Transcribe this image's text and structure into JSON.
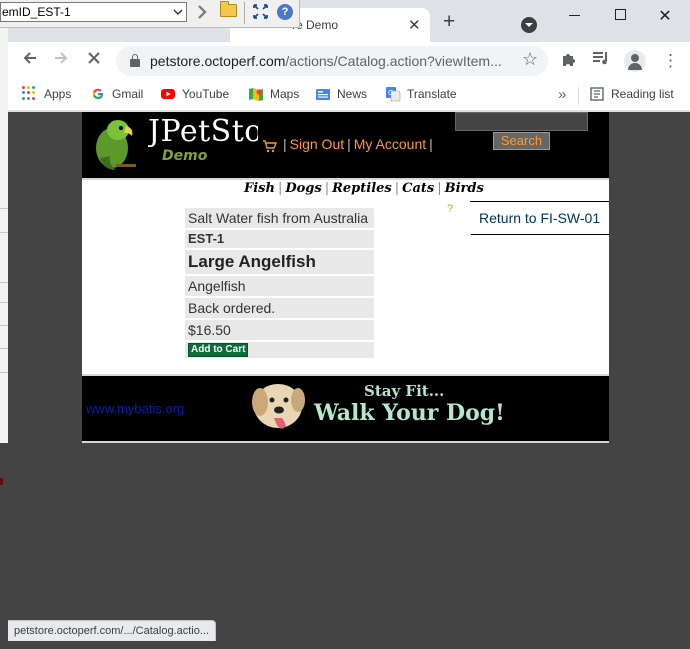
{
  "browser": {
    "tab_title": "re Demo",
    "new_tab_symbol": "+",
    "close_symbol": "✕",
    "url_host": "petstore.octoperf.com",
    "url_path": "/actions/Catalog.action?viewItem...",
    "bookmarks": [
      {
        "label": "Apps",
        "icon": "apps-grid-icon"
      },
      {
        "label": "Gmail",
        "icon": "google-icon"
      },
      {
        "label": "YouTube",
        "icon": "youtube-icon"
      },
      {
        "label": "Maps",
        "icon": "maps-icon"
      },
      {
        "label": "News",
        "icon": "news-icon"
      },
      {
        "label": "Translate",
        "icon": "translate-icon"
      }
    ],
    "more_bookmarks": "»",
    "reading_list": "Reading list",
    "status_url": "petstore.octoperf.com/.../Catalog.actio..."
  },
  "overlay": {
    "input_value": "emID_EST-1",
    "help_symbol": "?"
  },
  "header": {
    "logo_text": "JPetStore",
    "logo_sub": "Demo",
    "sign_out": "Sign Out",
    "my_account": "My Account",
    "search_button": "Search"
  },
  "nav": {
    "categories": [
      "Fish",
      "Dogs",
      "Reptiles",
      "Cats",
      "Birds"
    ]
  },
  "item": {
    "description": "Salt Water fish from Australia",
    "item_id": "EST-1",
    "name": "Large Angelfish",
    "product": "Angelfish",
    "stock": "Back ordered.",
    "price": "$16.50",
    "add_to_cart": "Add to Cart",
    "return_link": "Return to FI-SW-01"
  },
  "footer": {
    "mybatis_link": "www.mybatis.org",
    "banner_line1": "Stay Fit...",
    "banner_line2": "Walk Your Dog!"
  },
  "colors": {
    "header_link": "#ff9933",
    "return_link": "#003366",
    "add_to_cart_bg": "#0c6b38",
    "mybatis_link": "#0e1ea8",
    "banner_text": "#b5e6ce"
  }
}
